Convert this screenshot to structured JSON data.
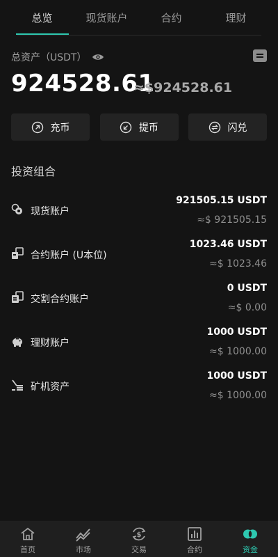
{
  "tabs": [
    {
      "label": "总览",
      "active": true
    },
    {
      "label": "现货账户",
      "active": false
    },
    {
      "label": "合约",
      "active": false
    },
    {
      "label": "理财",
      "active": false
    }
  ],
  "summary": {
    "label": "总资产（USDT）",
    "total": "924528.61",
    "approx": "≈$924528.61"
  },
  "actions": [
    {
      "label": "充币",
      "icon": "arrow-up-right-icon"
    },
    {
      "label": "提币",
      "icon": "arrow-down-left-icon"
    },
    {
      "label": "闪兑",
      "icon": "exchange-icon"
    }
  ],
  "portfolio": {
    "title": "投资组合",
    "rows": [
      {
        "name": "现货账户",
        "amount": "921505.15 USDT",
        "approx": "≈$ 921505.15",
        "icon": "spot-icon"
      },
      {
        "name": "合约账户 (U本位)",
        "amount": "1023.46 USDT",
        "approx": "≈$ 1023.46",
        "icon": "contract-icon"
      },
      {
        "name": "交割合约账户",
        "amount": "0 USDT",
        "approx": "≈$ 0.00",
        "icon": "delivery-icon"
      },
      {
        "name": "理财账户",
        "amount": "1000 USDT",
        "approx": "≈$ 1000.00",
        "icon": "piggy-bank-icon"
      },
      {
        "name": "矿机资产",
        "amount": "1000 USDT",
        "approx": "≈$ 1000.00",
        "icon": "mining-icon"
      }
    ]
  },
  "nav": [
    {
      "label": "首页",
      "icon": "home-icon",
      "active": false
    },
    {
      "label": "市场",
      "icon": "market-chart-icon",
      "active": false
    },
    {
      "label": "交易",
      "icon": "trade-icon",
      "active": false
    },
    {
      "label": "合约",
      "icon": "contract-chart-icon",
      "active": false
    },
    {
      "label": "资金",
      "icon": "assets-icon",
      "active": true
    }
  ],
  "colors": {
    "accent": "#2ec8b0",
    "background": "#141414",
    "card": "#232323"
  }
}
